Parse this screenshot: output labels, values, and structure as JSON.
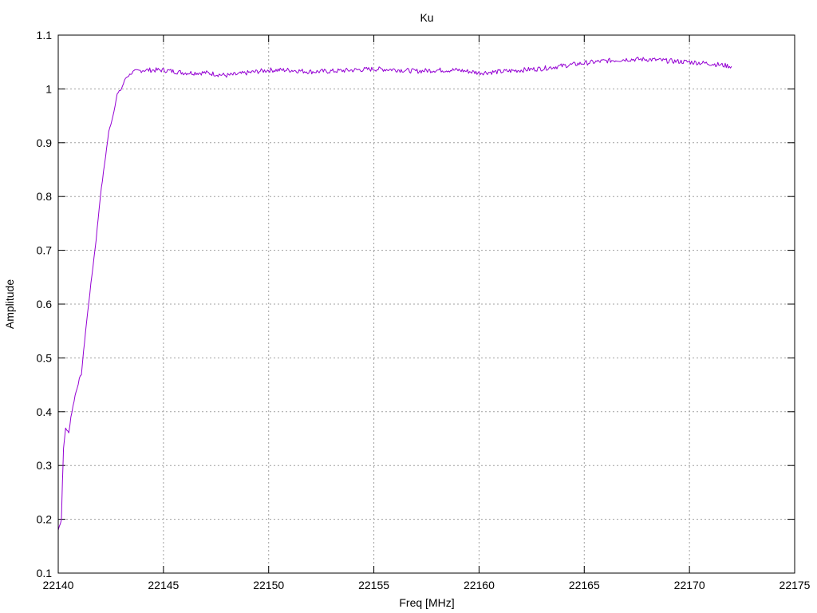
{
  "chart_data": {
    "type": "line",
    "title": "Ku",
    "xlabel": "Freq [MHz]",
    "ylabel": "Amplitude",
    "xlim": [
      22140,
      22175
    ],
    "ylim": [
      0.1,
      1.1
    ],
    "x_ticks": [
      "22140",
      "22145",
      "22150",
      "22155",
      "22160",
      "22165",
      "22170",
      "22175"
    ],
    "y_ticks": [
      "0.1",
      "0.2",
      "0.3",
      "0.4",
      "0.5",
      "0.6",
      "0.7",
      "0.8",
      "0.9",
      "1",
      "1.1"
    ],
    "grid": true,
    "legend": "none",
    "series": [
      {
        "color": "#9400d3",
        "x": [
          22140.0,
          22140.15,
          22140.2,
          22140.25,
          22140.35,
          22140.5,
          22140.6,
          22140.8,
          22141.0,
          22141.1,
          22141.3,
          22141.5,
          22141.8,
          22142.0,
          22142.2,
          22142.4,
          22142.6,
          22142.8,
          22143.0,
          22143.2,
          22143.5,
          22144.0,
          22144.5,
          22145.0,
          22146.0,
          22147.0,
          22148.0,
          22148.5,
          22149.0,
          22150.0,
          22151.0,
          22152.0,
          22153.0,
          22154.0,
          22155.0,
          22156.0,
          22157.0,
          22158.0,
          22159.0,
          22160.0,
          22161.0,
          22162.0,
          22163.0,
          22164.0,
          22165.0,
          22166.0,
          22167.0,
          22168.0,
          22169.0,
          22170.0,
          22171.0,
          22172.0
        ],
        "y": [
          0.18,
          0.2,
          0.27,
          0.33,
          0.37,
          0.36,
          0.39,
          0.43,
          0.46,
          0.47,
          0.55,
          0.62,
          0.72,
          0.8,
          0.86,
          0.92,
          0.95,
          0.99,
          1.0,
          1.02,
          1.03,
          1.035,
          1.035,
          1.035,
          1.03,
          1.03,
          1.025,
          1.027,
          1.03,
          1.035,
          1.035,
          1.032,
          1.033,
          1.035,
          1.037,
          1.036,
          1.033,
          1.035,
          1.035,
          1.03,
          1.032,
          1.035,
          1.038,
          1.043,
          1.048,
          1.052,
          1.055,
          1.055,
          1.052,
          1.05,
          1.047,
          1.042
        ]
      }
    ]
  }
}
